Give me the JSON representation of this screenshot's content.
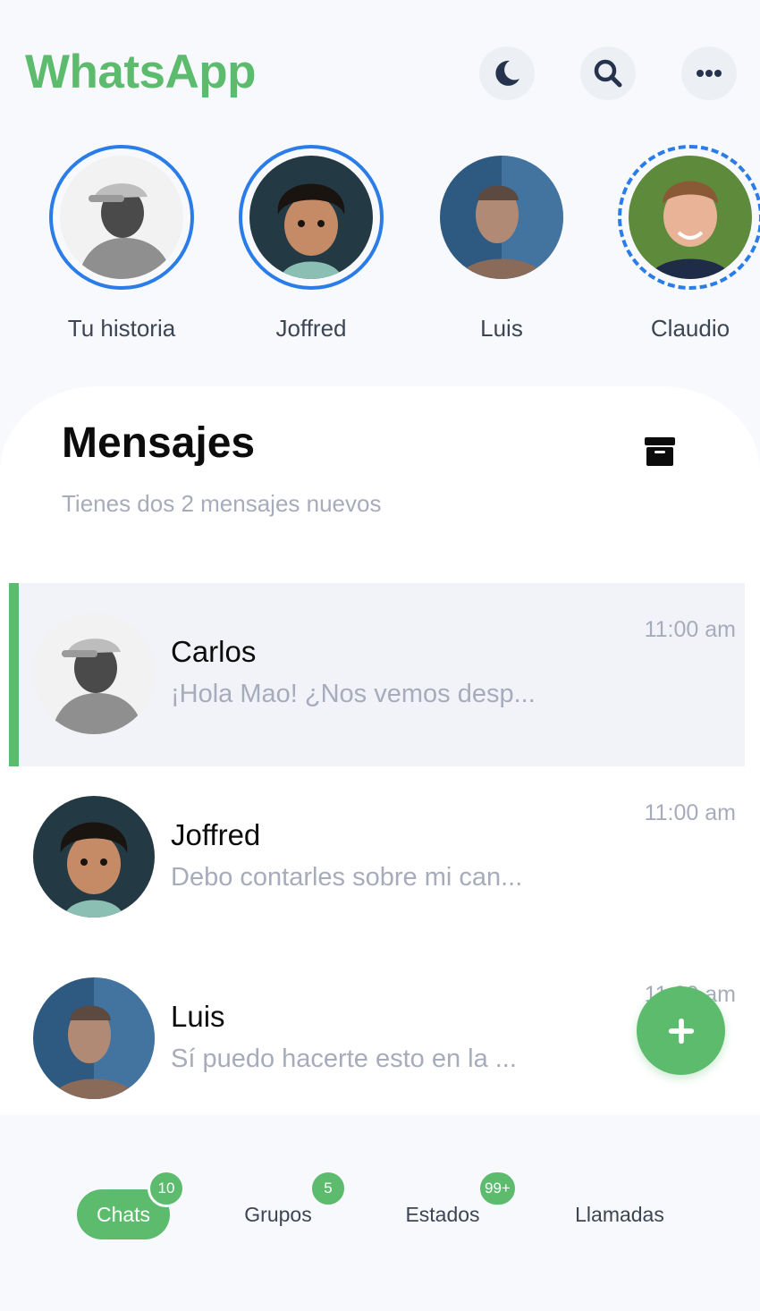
{
  "header": {
    "title": "WhatsApp",
    "buttons": [
      "moon-icon",
      "search-icon",
      "more-icon"
    ]
  },
  "stories": [
    {
      "label": "Tu historia",
      "ring": "solid"
    },
    {
      "label": "Joffred",
      "ring": "solid"
    },
    {
      "label": "Luis",
      "ring": "none"
    },
    {
      "label": "Claudio",
      "ring": "dashed"
    }
  ],
  "messages": {
    "title": "Mensajes",
    "subtitle": "Tienes dos 2 mensajes nuevos",
    "chats": [
      {
        "name": "Carlos",
        "preview": "¡Hola Mao! ¿Nos vemos desp...",
        "time": "11:00 am",
        "active": true
      },
      {
        "name": "Joffred",
        "preview": "Debo contarles sobre mi can...",
        "time": "11:00 am",
        "active": false
      },
      {
        "name": "Luis",
        "preview": "Sí puedo hacerte esto en la ...",
        "time": "11:00 am",
        "active": false
      }
    ]
  },
  "nav": {
    "items": [
      {
        "label": "Chats",
        "badge": "10",
        "active": true
      },
      {
        "label": "Grupos",
        "badge": "5",
        "active": false
      },
      {
        "label": "Estados",
        "badge": "99+",
        "active": false
      },
      {
        "label": "Llamadas",
        "badge": "",
        "active": false
      }
    ]
  },
  "colors": {
    "accent": "#5dbb6e",
    "story_ring": "#2a7de8",
    "background": "#f7f9fc",
    "muted_text": "#a6acbb"
  }
}
